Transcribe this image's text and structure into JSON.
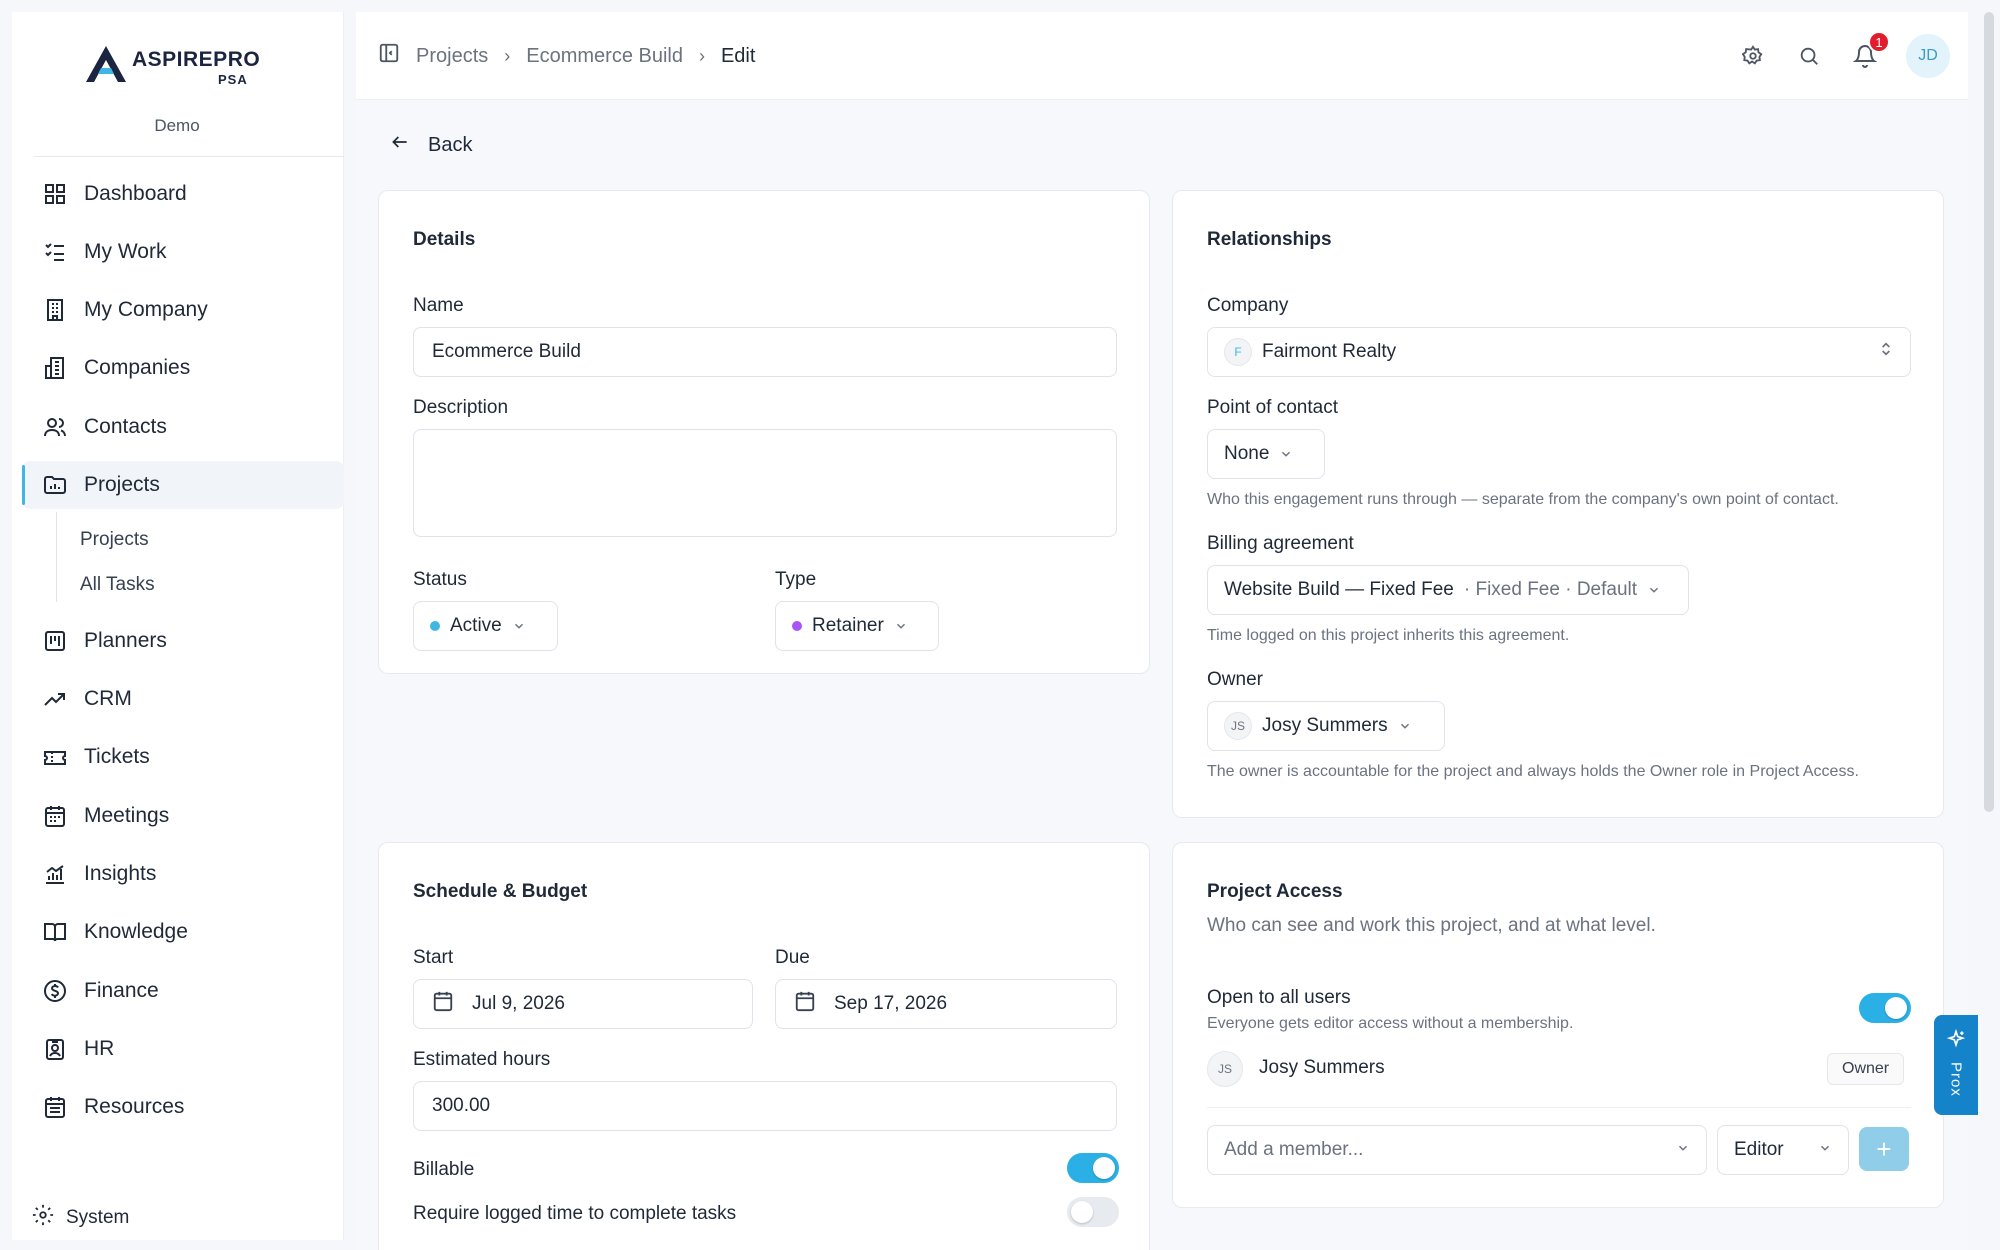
{
  "brand": {
    "name": "ASPIREPRO",
    "suffix": "PSA",
    "workspace": "Demo"
  },
  "sidebar": {
    "items": [
      {
        "label": "Dashboard",
        "icon": "grid-icon"
      },
      {
        "label": "My Work",
        "icon": "checklist-icon"
      },
      {
        "label": "My Company",
        "icon": "building-icon"
      },
      {
        "label": "Companies",
        "icon": "buildings-icon"
      },
      {
        "label": "Contacts",
        "icon": "users-icon"
      },
      {
        "label": "Projects",
        "icon": "folder-icon",
        "active": true
      },
      {
        "label": "Planners",
        "icon": "kanban-icon"
      },
      {
        "label": "CRM",
        "icon": "trend-icon"
      },
      {
        "label": "Tickets",
        "icon": "ticket-icon"
      },
      {
        "label": "Meetings",
        "icon": "calendar-icon"
      },
      {
        "label": "Insights",
        "icon": "bar-chart-icon"
      },
      {
        "label": "Knowledge",
        "icon": "book-icon"
      },
      {
        "label": "Finance",
        "icon": "dollar-icon"
      },
      {
        "label": "HR",
        "icon": "id-badge-icon"
      },
      {
        "label": "Resources",
        "icon": "calendar-grid-icon"
      }
    ],
    "sub_items": [
      "Projects",
      "All Tasks"
    ],
    "system_label": "System"
  },
  "breadcrumb": [
    "Projects",
    "Ecommerce Build",
    "Edit"
  ],
  "topbar": {
    "notification_count": "1",
    "user_initials": "JD"
  },
  "back_label": "Back",
  "details": {
    "title": "Details",
    "name_label": "Name",
    "name_value": "Ecommerce Build",
    "description_label": "Description",
    "status_label": "Status",
    "status_value": "Active",
    "type_label": "Type",
    "type_value": "Retainer"
  },
  "relationships": {
    "title": "Relationships",
    "company_label": "Company",
    "company_initial": "F",
    "company_value": "Fairmont Realty",
    "poc_label": "Point of contact",
    "poc_value": "None",
    "poc_hint": "Who this engagement runs through — separate from the company's own point of contact.",
    "billing_label": "Billing agreement",
    "billing_value": "Website Build — Fixed Fee",
    "billing_meta": "· Fixed Fee · Default",
    "billing_hint": "Time logged on this project inherits this agreement.",
    "owner_label": "Owner",
    "owner_initials": "JS",
    "owner_value": "Josy Summers",
    "owner_hint": "The owner is accountable for the project and always holds the Owner role in Project Access."
  },
  "schedule": {
    "title": "Schedule & Budget",
    "start_label": "Start",
    "start_value": "Jul 9, 2026",
    "due_label": "Due",
    "due_value": "Sep 17, 2026",
    "hours_label": "Estimated hours",
    "hours_value": "300.00",
    "billable_label": "Billable",
    "billable_on": true,
    "require_label": "Require logged time to complete tasks",
    "require_on": false
  },
  "access": {
    "title": "Project Access",
    "subtitle": "Who can see and work this project, and at what level.",
    "open_label": "Open to all users",
    "open_hint": "Everyone gets editor access without a membership.",
    "open_on": true,
    "member_initials": "JS",
    "member_name": "Josy Summers",
    "member_role": "Owner",
    "add_placeholder": "Add a member...",
    "role_value": "Editor",
    "add_button": "+"
  },
  "assistant": {
    "label": "Prox"
  },
  "colors": {
    "accent": "#2bb0e6",
    "active_dot": "#3fb6e6",
    "retainer_dot": "#a855f7",
    "badge": "#e11d2d",
    "brand": "#1b2540"
  }
}
